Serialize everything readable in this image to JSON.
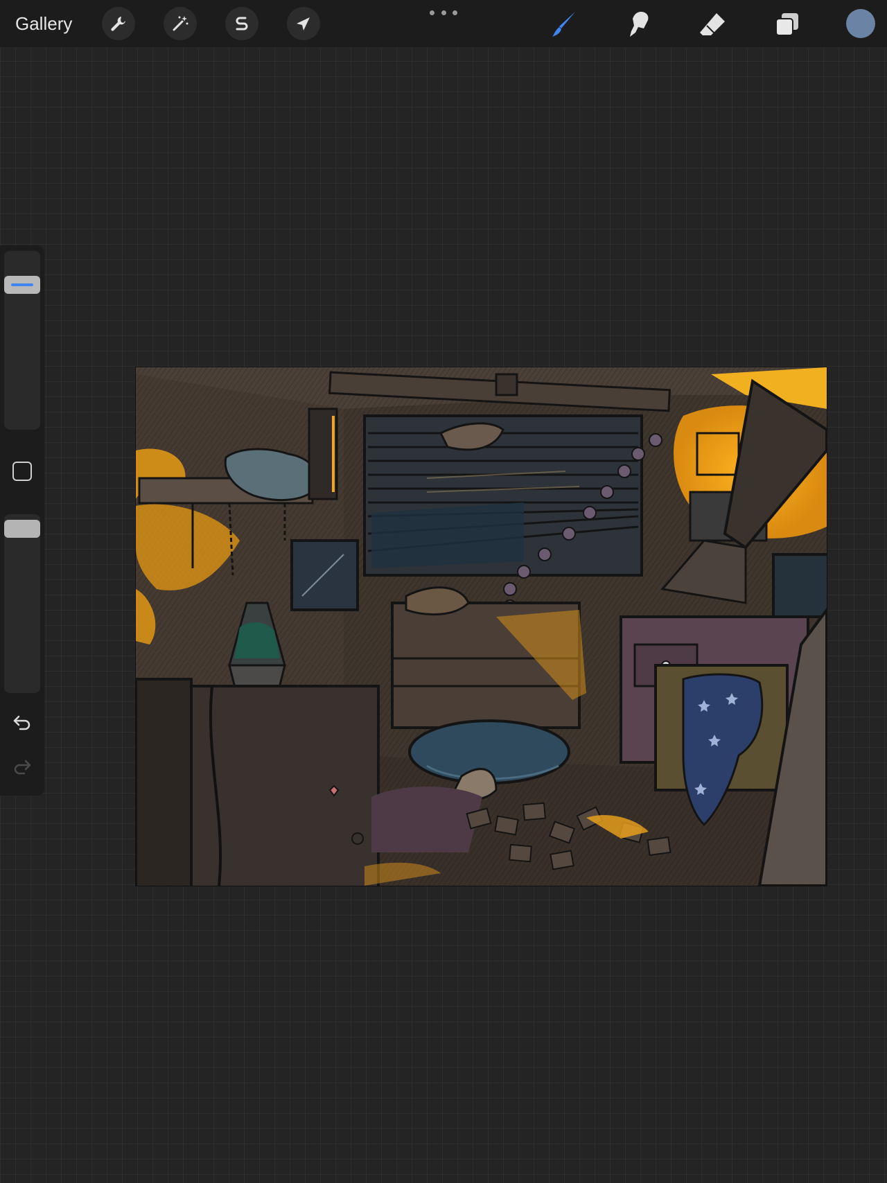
{
  "toolbar": {
    "gallery_label": "Gallery",
    "left_tools": [
      {
        "icon": "wrench-icon",
        "name": "actions"
      },
      {
        "icon": "magic-wand-icon",
        "name": "adjustments"
      },
      {
        "icon": "selection-s-icon",
        "name": "selection"
      },
      {
        "icon": "arrow-cursor-icon",
        "name": "transform"
      }
    ],
    "right_tools": [
      {
        "icon": "brush-icon",
        "name": "paint",
        "active": true
      },
      {
        "icon": "smudge-finger-icon",
        "name": "smudge"
      },
      {
        "icon": "eraser-icon",
        "name": "eraser"
      },
      {
        "icon": "layers-icon",
        "name": "layers"
      }
    ],
    "current_color": "#6b84a6",
    "active_tool_color": "#3f86f0"
  },
  "sidebar": {
    "brush_size_level": 0.13,
    "brush_opacity_level": 0.0,
    "icons": [
      "modify-square-icon",
      "undo-icon",
      "redo-icon"
    ]
  },
  "canvas": {
    "artwork": "cluttered-bedroom-illustration",
    "palette": {
      "wall": "#4a3f35",
      "shadow": "#2a2420",
      "light": "#f0a51a",
      "rug": "#2f4a5c",
      "dresser": "#5c4450",
      "blanket": "#2c3f6a"
    }
  }
}
